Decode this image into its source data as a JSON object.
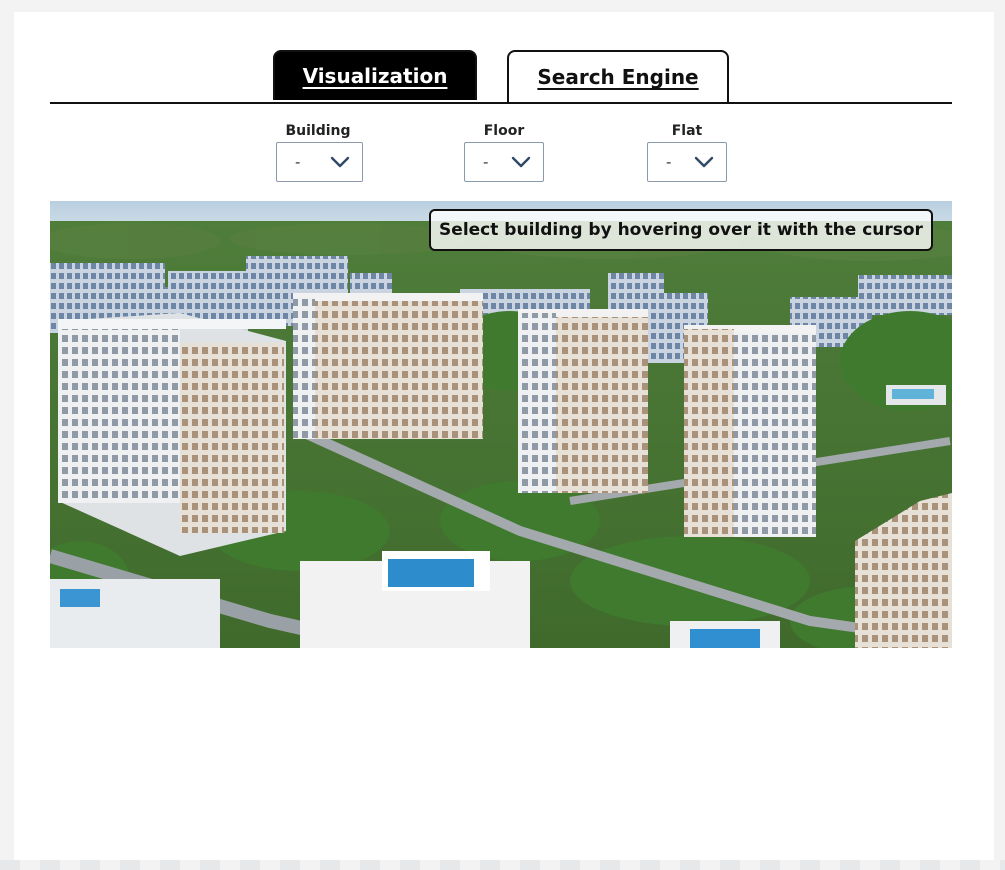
{
  "tabs": [
    {
      "label": "Visualization",
      "active": true
    },
    {
      "label": "Search Engine",
      "active": false
    }
  ],
  "filters": {
    "building": {
      "label": "Building",
      "value": "-"
    },
    "floor": {
      "label": "Floor",
      "value": "-"
    },
    "flat": {
      "label": "Flat",
      "value": "-"
    }
  },
  "hero": {
    "tooltip": "Select building by hovering over it with the cursor"
  },
  "colors": {
    "tab_active_bg": "#000000",
    "select_border": "#8a99ab",
    "chevron": "#2f4a66"
  }
}
